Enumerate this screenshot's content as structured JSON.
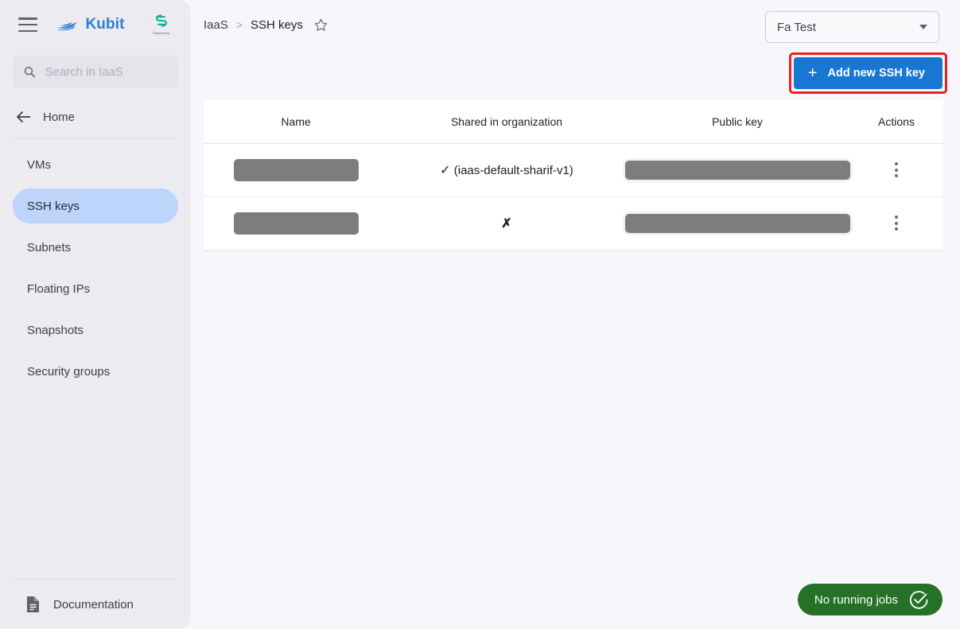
{
  "app": {
    "brand_name": "Kubit",
    "brand_color": "#2a7fd4",
    "partner_logo_name": "partner-logo",
    "partner_sub_text": "Powered by"
  },
  "sidebar": {
    "menu_icon": "hamburger-icon",
    "search": {
      "placeholder": "Search in IaaS",
      "value": "",
      "icon": "search-icon"
    },
    "home": {
      "label": "Home",
      "icon": "arrow-left-icon"
    },
    "items": [
      {
        "label": "VMs",
        "active": false
      },
      {
        "label": "SSH keys",
        "active": true
      },
      {
        "label": "Subnets",
        "active": false
      },
      {
        "label": "Floating IPs",
        "active": false
      },
      {
        "label": "Snapshots",
        "active": false
      },
      {
        "label": "Security groups",
        "active": false
      }
    ],
    "active_color": "#bdd4fb",
    "documentation": {
      "label": "Documentation",
      "icon": "document-icon"
    }
  },
  "header": {
    "breadcrumb": {
      "root": "IaaS",
      "separator": ">",
      "current": "SSH keys",
      "favorite_icon": "star-outline-icon"
    },
    "project_selector": {
      "value": "Fa Test",
      "icon": "chevron-down-icon"
    },
    "add_button": {
      "label": "Add new SSH key",
      "icon": "plus-icon",
      "color": "#1877d2",
      "highlight_color": "#ef1f1f"
    }
  },
  "table": {
    "columns": [
      "Name",
      "Shared in organization",
      "Public key",
      "Actions"
    ],
    "rows": [
      {
        "name": "",
        "name_redacted": true,
        "shared_mark": "✓",
        "shared_detail": "(iaas-default-sharif-v1)",
        "public_key": "",
        "public_key_redacted": true,
        "actions_icon": "more-vertical-icon"
      },
      {
        "name": "",
        "name_redacted": true,
        "shared_mark": "✗",
        "shared_detail": "",
        "public_key": "",
        "public_key_redacted": true,
        "actions_icon": "more-vertical-icon"
      }
    ]
  },
  "status": {
    "label": "No running jobs",
    "icon": "check-circle-icon",
    "color": "#257127"
  }
}
